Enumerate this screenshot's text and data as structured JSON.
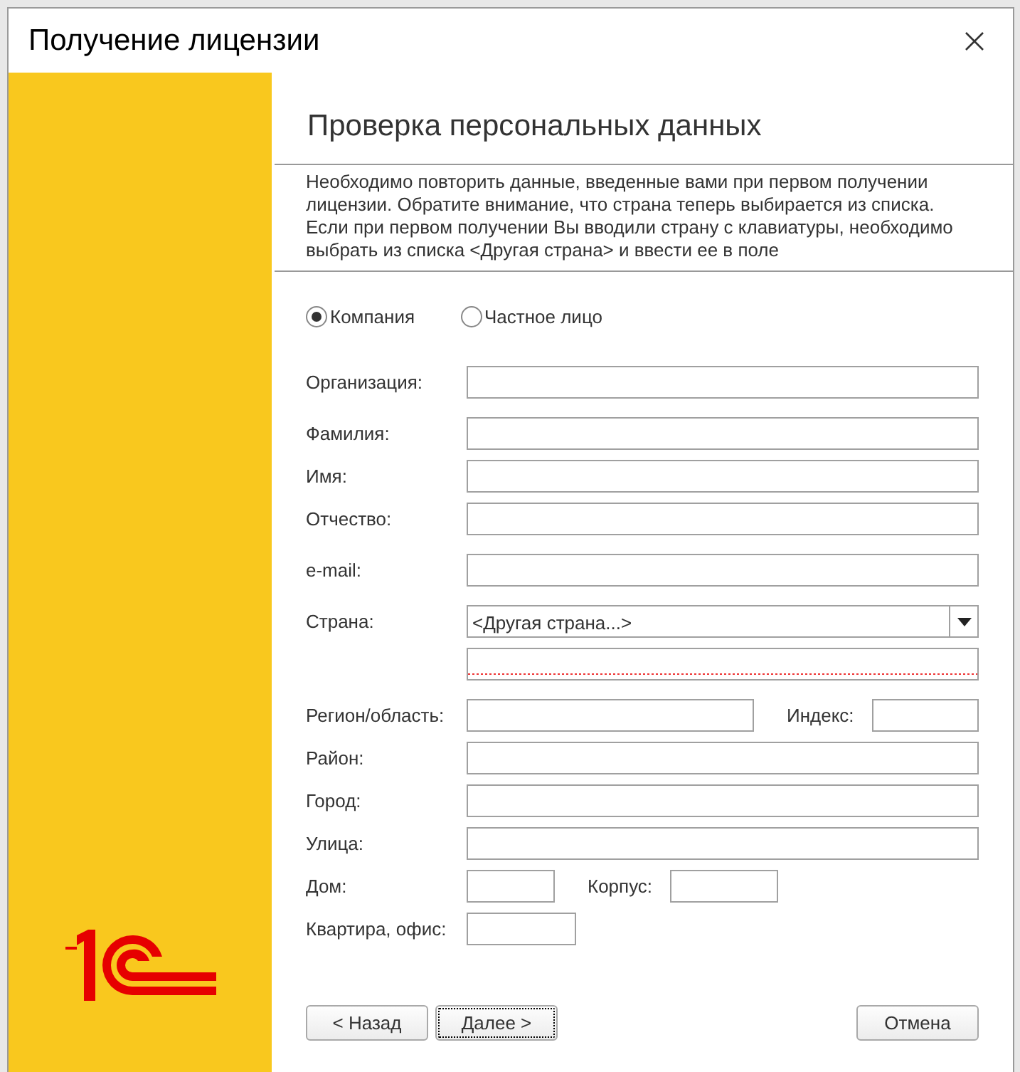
{
  "window": {
    "title": "Получение лицензии"
  },
  "page_title": "Проверка персональных данных",
  "description": "Необходимо повторить данные, введенные вами при первом получении лицензии. Обратите внимание, что страна теперь выбирается из списка. Если при первом получении Вы вводили страну с клавиатуры, необходимо выбрать из списка <Другая страна> и ввести ее в поле",
  "person_type": [
    {
      "label": "Компания",
      "selected": true
    },
    {
      "label": "Частное лицо",
      "selected": false
    }
  ],
  "form_groups": [
    [
      {
        "kind": "text",
        "label": "Организация:"
      }
    ],
    [
      {
        "kind": "text",
        "label": "Фамилия:"
      },
      {
        "kind": "text",
        "label": "Имя:"
      },
      {
        "kind": "text",
        "label": "Отчество:"
      }
    ],
    [
      {
        "kind": "text",
        "label": "e-mail:"
      }
    ],
    [
      {
        "kind": "select",
        "label": "Страна:",
        "value": "<Другая страна...>"
      },
      {
        "kind": "text",
        "invalid": true
      }
    ],
    [
      {
        "kind": "region-index",
        "label": "Регион/область:",
        "second_label": "Индекс:"
      },
      {
        "kind": "text",
        "label": "Район:"
      },
      {
        "kind": "text",
        "label": "Город:"
      },
      {
        "kind": "text",
        "label": "Улица:"
      },
      {
        "kind": "house-building",
        "label": "Дом:",
        "second_label": "Корпус:"
      },
      {
        "kind": "short",
        "label": "Квартира, офис:"
      }
    ]
  ],
  "buttons": [
    {
      "label": "< Назад",
      "kind": "back",
      "focused": false
    },
    {
      "label": "Далее >",
      "kind": "next",
      "focused": true
    },
    {
      "label": "Отмена",
      "kind": "cancel",
      "focused": false
    }
  ]
}
